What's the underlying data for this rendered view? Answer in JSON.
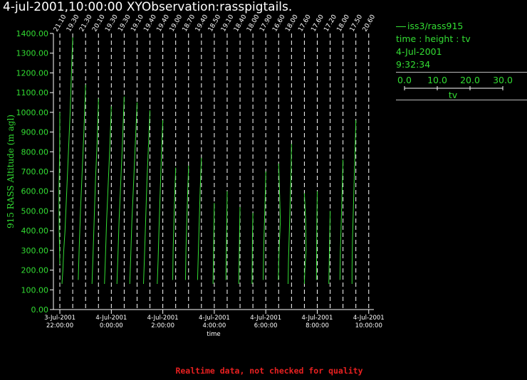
{
  "header": {
    "title": "4-jul-2001,10:00:00  XYObservation:rasspigtails."
  },
  "legend": {
    "series": "iss3/rass915",
    "variables": "time : height : tv",
    "date": "4-Jul-2001",
    "time": "9:32:34",
    "scale_ticks": [
      "0.0",
      "10.0",
      "20.0",
      "30.0"
    ],
    "scale_label": "tv"
  },
  "notice": "Realtime data, not checked for quality",
  "colors": {
    "background": "#000000",
    "trace": "#33dd33",
    "axis": "#ffffff",
    "grid": "#ffffff",
    "notice": "#e82020"
  },
  "chart_data": {
    "type": "line",
    "title": "",
    "xlabel": "time",
    "ylabel": "915 RASS Altitude (m agl)",
    "ylim": [
      0,
      1400
    ],
    "y_ticks": [
      "0.00",
      "100.00",
      "200.00",
      "300.00",
      "400.00",
      "500.00",
      "600.00",
      "700.00",
      "800.00",
      "900.00",
      "1000.00",
      "1100.00",
      "1200.00",
      "1300.00",
      "1400.00"
    ],
    "xlim_hours": [
      -2.25,
      10.2
    ],
    "x_ticks": [
      {
        "hour": -2,
        "date": "3-Jul-2001",
        "time": "22:00:00"
      },
      {
        "hour": 0,
        "date": "4-Jul-2001",
        "time": "0:00:00"
      },
      {
        "hour": 2,
        "date": "4-Jul-2001",
        "time": "2:00:00"
      },
      {
        "hour": 4,
        "date": "4-Jul-2001",
        "time": "4:00:00"
      },
      {
        "hour": 6,
        "date": "4-Jul-2001",
        "time": "6:00:00"
      },
      {
        "hour": 8,
        "date": "4-Jul-2001",
        "time": "8:00:00"
      },
      {
        "hour": 10,
        "date": "4-Jul-2001",
        "time": "10:00:00"
      }
    ],
    "grid": "vertical dashed lines at each profile time",
    "profile_scale": "tv offset of 30.0 spans one profile interval",
    "profiles": [
      {
        "hour": -2.0,
        "label": "21.10",
        "points": [
          [
            0,
            230
          ],
          [
            -1.5,
            400
          ],
          [
            -2,
            600
          ],
          [
            -0.5,
            800
          ],
          [
            0,
            1000
          ]
        ]
      },
      {
        "hour": -1.5,
        "label": "19.30",
        "points": [
          [
            0,
            1380
          ],
          [
            -3,
            1200
          ],
          [
            -6,
            1000
          ],
          [
            -10,
            800
          ],
          [
            -14,
            600
          ],
          [
            -18,
            400
          ],
          [
            -21,
            300
          ],
          [
            -23,
            200
          ],
          [
            -25,
            130
          ]
        ]
      },
      {
        "hour": -1.0,
        "label": "21.30",
        "points": [
          [
            0,
            1140
          ],
          [
            -4,
            900
          ],
          [
            -8,
            700
          ],
          [
            -12,
            500
          ],
          [
            -15,
            300
          ],
          [
            -17,
            150
          ]
        ]
      },
      {
        "hour": -0.5,
        "label": "20.10",
        "points": [
          [
            0,
            1070
          ],
          [
            -3,
            850
          ],
          [
            -7,
            650
          ],
          [
            -10,
            450
          ],
          [
            -13,
            250
          ],
          [
            -15,
            130
          ]
        ]
      },
      {
        "hour": 0.0,
        "label": "19.30",
        "points": [
          [
            0,
            1030
          ],
          [
            -3,
            850
          ],
          [
            -7,
            650
          ],
          [
            -11,
            450
          ],
          [
            -14,
            250
          ],
          [
            -16,
            130
          ]
        ]
      },
      {
        "hour": 0.5,
        "label": "19.30",
        "points": [
          [
            0,
            1080
          ],
          [
            -4,
            850
          ],
          [
            -8,
            650
          ],
          [
            -12,
            450
          ],
          [
            -15,
            250
          ],
          [
            -17,
            130
          ]
        ]
      },
      {
        "hour": 1.0,
        "label": "19.10",
        "points": [
          [
            0,
            1050
          ],
          [
            -4,
            850
          ],
          [
            -8,
            650
          ],
          [
            -12,
            450
          ],
          [
            -15,
            250
          ],
          [
            -17,
            130
          ]
        ]
      },
      {
        "hour": 1.5,
        "label": "19.40",
        "points": [
          [
            0,
            1010
          ],
          [
            -3,
            850
          ],
          [
            -7,
            650
          ],
          [
            -10,
            450
          ],
          [
            -13,
            250
          ],
          [
            -15,
            130
          ]
        ]
      },
      {
        "hour": 2.0,
        "label": "19.40",
        "points": [
          [
            0,
            960
          ],
          [
            -3,
            800
          ],
          [
            -6,
            600
          ],
          [
            -9,
            400
          ],
          [
            -11,
            250
          ],
          [
            -13,
            130
          ]
        ]
      },
      {
        "hour": 2.5,
        "label": "19.00",
        "points": [
          [
            0,
            720
          ],
          [
            -2,
            600
          ],
          [
            -4,
            450
          ],
          [
            -6,
            300
          ],
          [
            -7,
            150
          ]
        ]
      },
      {
        "hour": 3.0,
        "label": "18.70",
        "points": [
          [
            0,
            730
          ],
          [
            -2,
            600
          ],
          [
            -4,
            450
          ],
          [
            -6,
            300
          ],
          [
            -7,
            150
          ]
        ]
      },
      {
        "hour": 3.5,
        "label": "19.40",
        "points": [
          [
            0,
            770
          ],
          [
            -3,
            600
          ],
          [
            -5,
            450
          ],
          [
            -7,
            300
          ],
          [
            -9,
            150
          ]
        ]
      },
      {
        "hour": 4.0,
        "label": "18.50",
        "points": [
          [
            0,
            540
          ],
          [
            -1,
            400
          ],
          [
            -2,
            250
          ],
          [
            -3,
            130
          ]
        ]
      },
      {
        "hour": 4.5,
        "label": "19.10",
        "points": [
          [
            0,
            600
          ],
          [
            -1,
            450
          ],
          [
            -2,
            300
          ],
          [
            -3,
            150
          ]
        ]
      },
      {
        "hour": 5.0,
        "label": "18.40",
        "points": [
          [
            0,
            520
          ],
          [
            -1,
            400
          ],
          [
            -2,
            250
          ],
          [
            -3,
            130
          ]
        ]
      },
      {
        "hour": 5.5,
        "label": "18.00",
        "points": [
          [
            0,
            490
          ],
          [
            -1,
            380
          ],
          [
            -1.5,
            250
          ],
          [
            -2,
            130
          ]
        ]
      },
      {
        "hour": 6.0,
        "label": "17.90",
        "points": [
          [
            0,
            700
          ],
          [
            -1,
            600
          ],
          [
            -3,
            450
          ],
          [
            -5,
            300
          ],
          [
            -6,
            150
          ]
        ]
      },
      {
        "hour": 6.5,
        "label": "16.60",
        "points": [
          [
            0,
            740
          ],
          [
            2,
            600
          ],
          [
            4,
            450
          ],
          [
            1,
            300
          ],
          [
            -1,
            150
          ]
        ]
      },
      {
        "hour": 7.0,
        "label": "18.00",
        "points": [
          [
            0,
            840
          ],
          [
            -1,
            700
          ],
          [
            -3,
            550
          ],
          [
            -5,
            400
          ],
          [
            -7,
            250
          ],
          [
            -8,
            130
          ]
        ]
      },
      {
        "hour": 7.5,
        "label": "17.60",
        "points": [
          [
            0,
            590
          ],
          [
            3,
            450
          ],
          [
            4,
            300
          ],
          [
            1,
            200
          ],
          [
            0,
            130
          ]
        ]
      },
      {
        "hour": 8.0,
        "label": "17.60",
        "points": [
          [
            0,
            600
          ],
          [
            -1,
            450
          ],
          [
            -1.5,
            300
          ],
          [
            -2,
            150
          ]
        ]
      },
      {
        "hour": 8.5,
        "label": "17.20",
        "points": [
          [
            0,
            500
          ],
          [
            -1,
            380
          ],
          [
            -2,
            250
          ],
          [
            -3,
            130
          ]
        ]
      },
      {
        "hour": 9.0,
        "label": "18.00",
        "points": [
          [
            0,
            760
          ],
          [
            -2,
            600
          ],
          [
            -4,
            450
          ],
          [
            -6,
            300
          ],
          [
            -7,
            150
          ]
        ]
      },
      {
        "hour": 9.5,
        "label": "17.50",
        "points": [
          [
            0,
            960
          ],
          [
            -2,
            800
          ],
          [
            -4,
            650
          ],
          [
            -6,
            500
          ],
          [
            -8,
            350
          ],
          [
            -9,
            200
          ],
          [
            -9,
            130
          ]
        ]
      },
      {
        "hour": 10.0,
        "label": "20.60",
        "points": []
      }
    ]
  }
}
